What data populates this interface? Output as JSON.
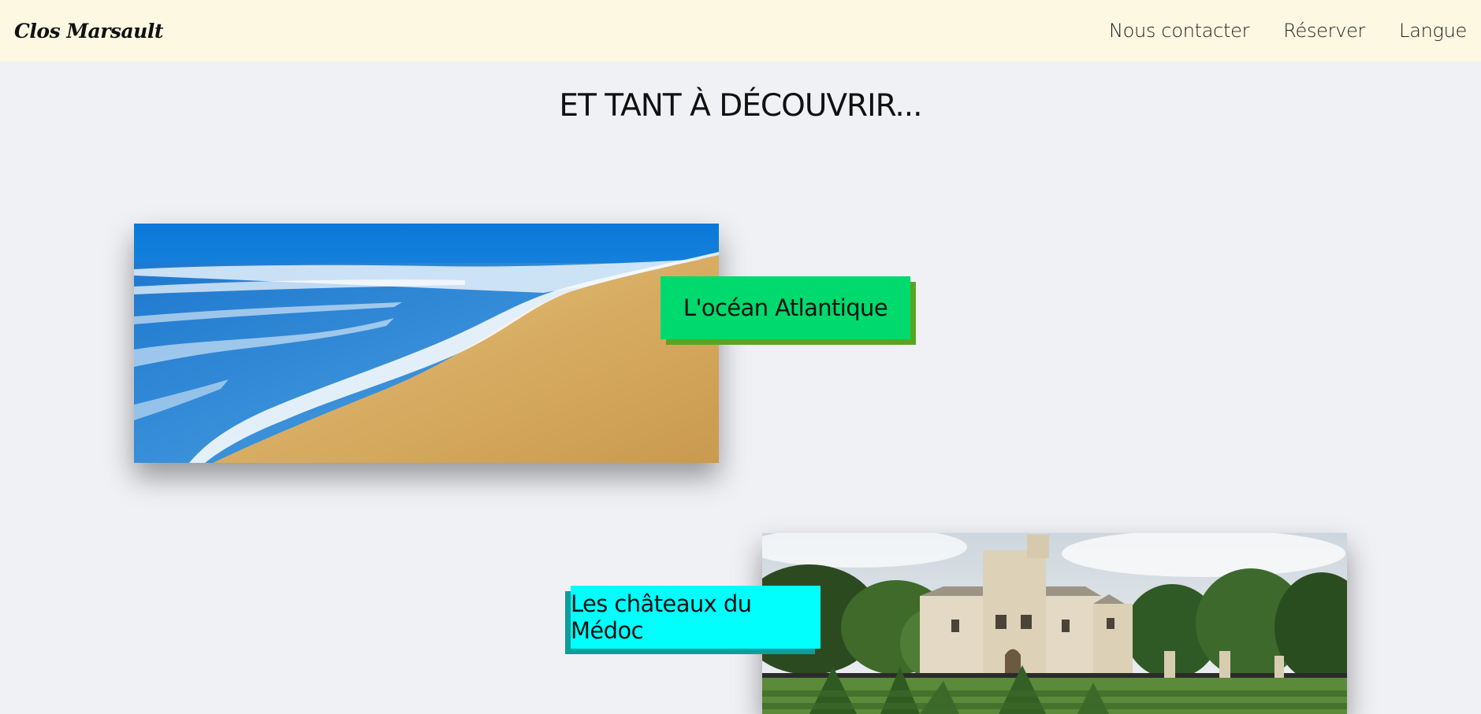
{
  "header": {
    "brand": "Clos Marsault",
    "nav": [
      "Nous contacter",
      "Réserver",
      "Langue"
    ]
  },
  "main": {
    "title": "ET TANT À DÉCOUVRIR...",
    "cards": [
      {
        "label": "L'océan Atlantique",
        "image": "beach-photo",
        "accent": "#00d96d",
        "shadow": "#56a623"
      },
      {
        "label": "Les châteaux du Médoc",
        "image": "chateau-photo",
        "accent": "#00fffd",
        "shadow": "#0e9d9b"
      }
    ]
  },
  "colors": {
    "header_bg": "#fdf8e1",
    "page_bg": "#f0f1f5"
  }
}
